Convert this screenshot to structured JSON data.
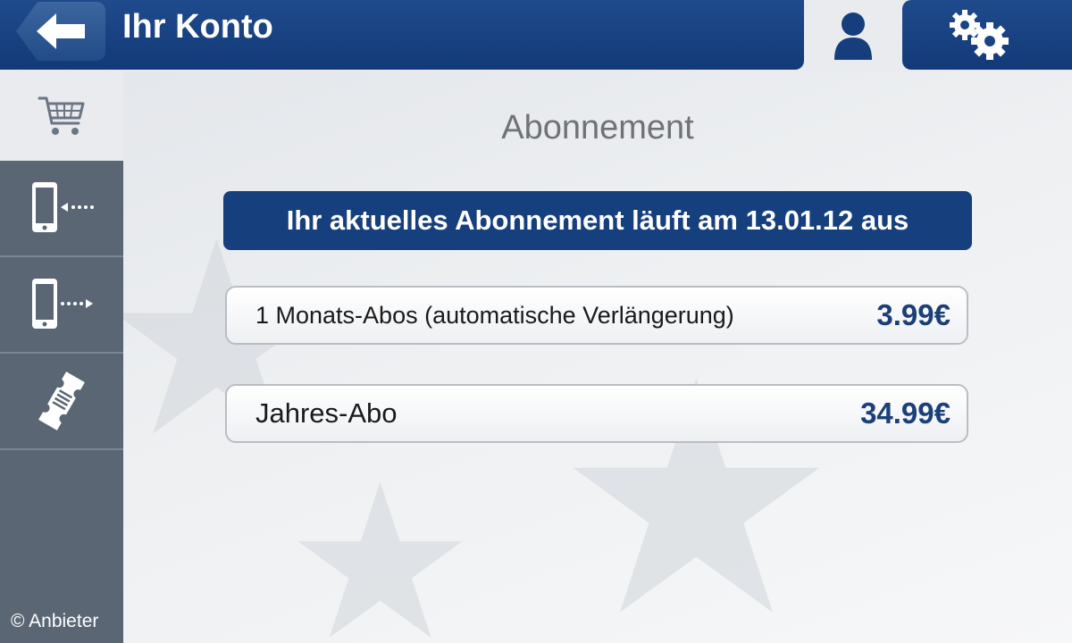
{
  "header": {
    "title": "Ihr Konto",
    "back_icon": "arrow-left-icon",
    "tabs": [
      {
        "icon": "user-icon",
        "active": true
      },
      {
        "icon": "gears-icon",
        "active": false
      }
    ]
  },
  "sidebar": {
    "items": [
      {
        "icon": "cart-icon",
        "active": true
      },
      {
        "icon": "phone-import-icon",
        "active": false
      },
      {
        "icon": "phone-export-icon",
        "active": false
      },
      {
        "icon": "ticket-icon",
        "active": false
      }
    ]
  },
  "main": {
    "section_title": "Abonnement",
    "status_text": "Ihr aktuelles Abonnement läuft am 13.01.12 aus",
    "options": [
      {
        "label": "1 Monats-Abos (automatische Verlängerung)",
        "price": "3.99€"
      },
      {
        "label": "Jahres-Abo",
        "price": "34.99€"
      }
    ]
  },
  "footer": {
    "copyright": "© Anbieter"
  },
  "colors": {
    "header_blue": "#1a4385",
    "banner_blue": "#163f7e",
    "price_blue": "#1b3f78",
    "sidebar_gray": "#5a6674",
    "background": "#e9ebee"
  }
}
